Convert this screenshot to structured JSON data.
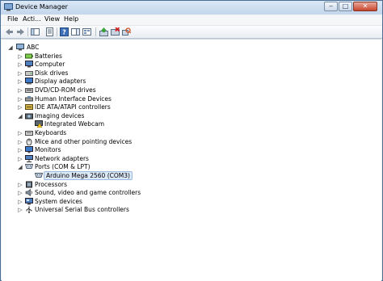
{
  "window": {
    "title": "Device Manager",
    "buttons": {
      "minimize": "‒",
      "maximize": "□",
      "close": "✕"
    }
  },
  "menu": [
    "File",
    "Acti...",
    "View",
    "Help"
  ],
  "toolbar": {
    "icons": [
      "back-arrow-icon",
      "forward-arrow-icon",
      "show-hide-tree-icon",
      "properties-icon",
      "help-icon",
      "action-pane-icon",
      "view-icon",
      "update-driver-icon",
      "disable-device-icon",
      "scan-hardware-icon"
    ]
  },
  "tree": {
    "root": "ABC",
    "items": [
      {
        "label": "Batteries",
        "icon": "battery-icon",
        "expanded": false
      },
      {
        "label": "Computer",
        "icon": "computer-icon",
        "expanded": false
      },
      {
        "label": "Disk drives",
        "icon": "disk-drive-icon",
        "expanded": false
      },
      {
        "label": "Display adapters",
        "icon": "display-adapter-icon",
        "expanded": false
      },
      {
        "label": "DVD/CD-ROM drives",
        "icon": "dvd-drive-icon",
        "expanded": false
      },
      {
        "label": "Human Interface Devices",
        "icon": "hid-icon",
        "expanded": false
      },
      {
        "label": "IDE ATA/ATAPI controllers",
        "icon": "ide-controller-icon",
        "expanded": false
      },
      {
        "label": "Imaging devices",
        "icon": "camera-icon",
        "expanded": true,
        "children": [
          {
            "label": "Integrated Webcam",
            "icon": "webcam-warning-icon"
          }
        ]
      },
      {
        "label": "Keyboards",
        "icon": "keyboard-icon",
        "expanded": false
      },
      {
        "label": "Mice and other pointing devices",
        "icon": "mouse-icon",
        "expanded": false
      },
      {
        "label": "Monitors",
        "icon": "monitor-icon",
        "expanded": false
      },
      {
        "label": "Network adapters",
        "icon": "network-adapter-icon",
        "expanded": false
      },
      {
        "label": "Ports (COM & LPT)",
        "icon": "port-icon",
        "expanded": true,
        "children": [
          {
            "label": "Arduino Mega 2560 (COM3)",
            "icon": "port-icon",
            "selected": true
          }
        ]
      },
      {
        "label": "Processors",
        "icon": "processor-icon",
        "expanded": false
      },
      {
        "label": "Sound, video and game controllers",
        "icon": "sound-icon",
        "expanded": false
      },
      {
        "label": "System devices",
        "icon": "system-devices-icon",
        "expanded": false
      },
      {
        "label": "Universal Serial Bus controllers",
        "icon": "usb-icon",
        "expanded": false
      }
    ]
  },
  "colors": {
    "selection_bg": "#dbe8f6",
    "selection_border": "#9bbbe0",
    "warning": "#f2c521",
    "title_gradient_top": "#dbe8f6"
  }
}
